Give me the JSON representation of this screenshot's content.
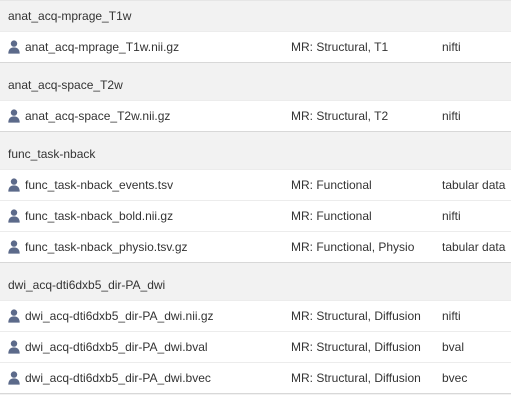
{
  "groups": [
    {
      "title": "anat_acq-mprage_T1w",
      "files": [
        {
          "name": "anat_acq-mprage_T1w.nii.gz",
          "modality": "MR: Structural, T1",
          "type": "nifti",
          "icon": "user-icon"
        }
      ]
    },
    {
      "title": "anat_acq-space_T2w",
      "files": [
        {
          "name": "anat_acq-space_T2w.nii.gz",
          "modality": "MR: Structural, T2",
          "type": "nifti",
          "icon": "user-icon"
        }
      ]
    },
    {
      "title": "func_task-nback",
      "files": [
        {
          "name": "func_task-nback_events.tsv",
          "modality": "MR: Functional",
          "type": "tabular data",
          "icon": "user-icon"
        },
        {
          "name": "func_task-nback_bold.nii.gz",
          "modality": "MR: Functional",
          "type": "nifti",
          "icon": "user-icon"
        },
        {
          "name": "func_task-nback_physio.tsv.gz",
          "modality": "MR: Functional, Physio",
          "type": "tabular data",
          "icon": "user-icon"
        }
      ]
    },
    {
      "title": "dwi_acq-dti6dxb5_dir-PA_dwi",
      "files": [
        {
          "name": "dwi_acq-dti6dxb5_dir-PA_dwi.nii.gz",
          "modality": "MR: Structural, Diffusion",
          "type": "nifti",
          "icon": "user-icon"
        },
        {
          "name": "dwi_acq-dti6dxb5_dir-PA_dwi.bval",
          "modality": "MR: Structural, Diffusion",
          "type": "bval",
          "icon": "user-icon"
        },
        {
          "name": "dwi_acq-dti6dxb5_dir-PA_dwi.bvec",
          "modality": "MR: Structural, Diffusion",
          "type": "bvec",
          "icon": "user-icon"
        }
      ]
    }
  ],
  "colors": {
    "icon": "#5c6a8a",
    "text": "#333333",
    "header_bg": "#f2f2f2",
    "row_bg": "#ffffff"
  }
}
